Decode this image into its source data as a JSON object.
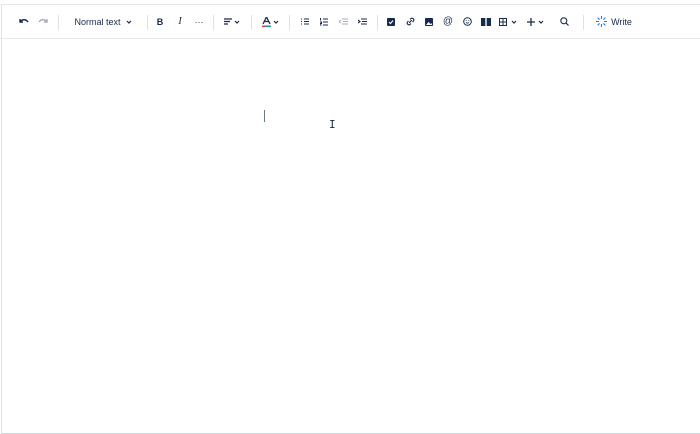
{
  "toolbar": {
    "text_style": "Normal text",
    "write_label": "Write",
    "ai_color": "#1d7afc"
  },
  "icons": [
    "undo-icon",
    "redo-icon",
    "bold-icon",
    "italic-icon",
    "more-icon",
    "align-icon",
    "text-color-icon",
    "bullet-list-icon",
    "numbered-list-icon",
    "outdent-icon",
    "indent-icon",
    "task-icon",
    "link-icon",
    "image-icon",
    "mention-icon",
    "emoji-icon",
    "layout-icon",
    "table-icon",
    "insert-icon",
    "search-icon",
    "ai-write-icon"
  ]
}
